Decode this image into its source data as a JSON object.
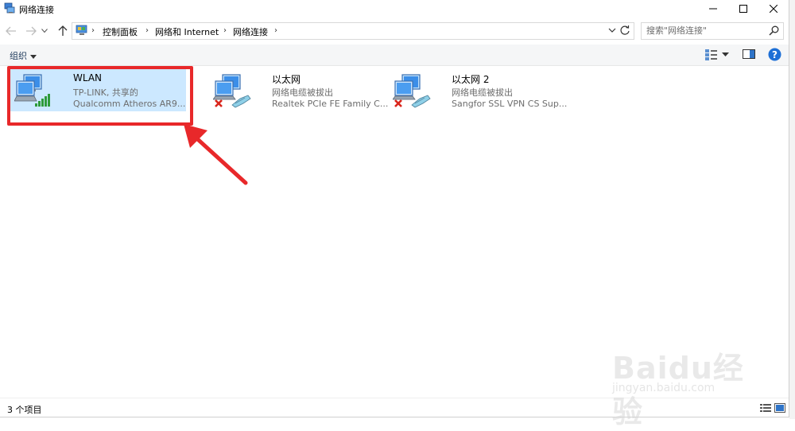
{
  "window": {
    "title": "网络连接",
    "minimize_glyph": "—",
    "maximize_glyph": "☐",
    "close_glyph": "✕"
  },
  "nav": {
    "back_icon": "arrow-left-icon",
    "forward_icon": "arrow-right-icon",
    "recent_icon": "chevron-down-icon",
    "up_icon": "arrow-up-icon"
  },
  "address": {
    "breadcrumbs": [
      "控制面板",
      "网络和 Internet",
      "网络连接"
    ],
    "separator": "›"
  },
  "search": {
    "placeholder": "搜索\"网络连接\""
  },
  "toolbar": {
    "organize_label": "组织"
  },
  "connections": [
    {
      "name": "WLAN",
      "status": "TP-LINK, 共享的",
      "device": "Qualcomm Atheros AR9...",
      "icon": "wireless-network-icon",
      "selected": true,
      "disconnected": false
    },
    {
      "name": "以太网",
      "status": "网络电缆被拔出",
      "device": "Realtek PCIe FE Family C...",
      "icon": "ethernet-network-icon",
      "selected": false,
      "disconnected": true
    },
    {
      "name": "以太网 2",
      "status": "网络电缆被拔出",
      "device": "Sangfor SSL VPN CS Sup...",
      "icon": "ethernet-network-icon",
      "selected": false,
      "disconnected": true
    }
  ],
  "statusbar": {
    "item_count": "3 个项目"
  },
  "watermark": {
    "brand": "Baidu经验",
    "url": "jingyan.baidu.com"
  },
  "colors": {
    "selection": "#cce8ff",
    "annotation": "#e8282a",
    "accent": "#0063b1"
  }
}
